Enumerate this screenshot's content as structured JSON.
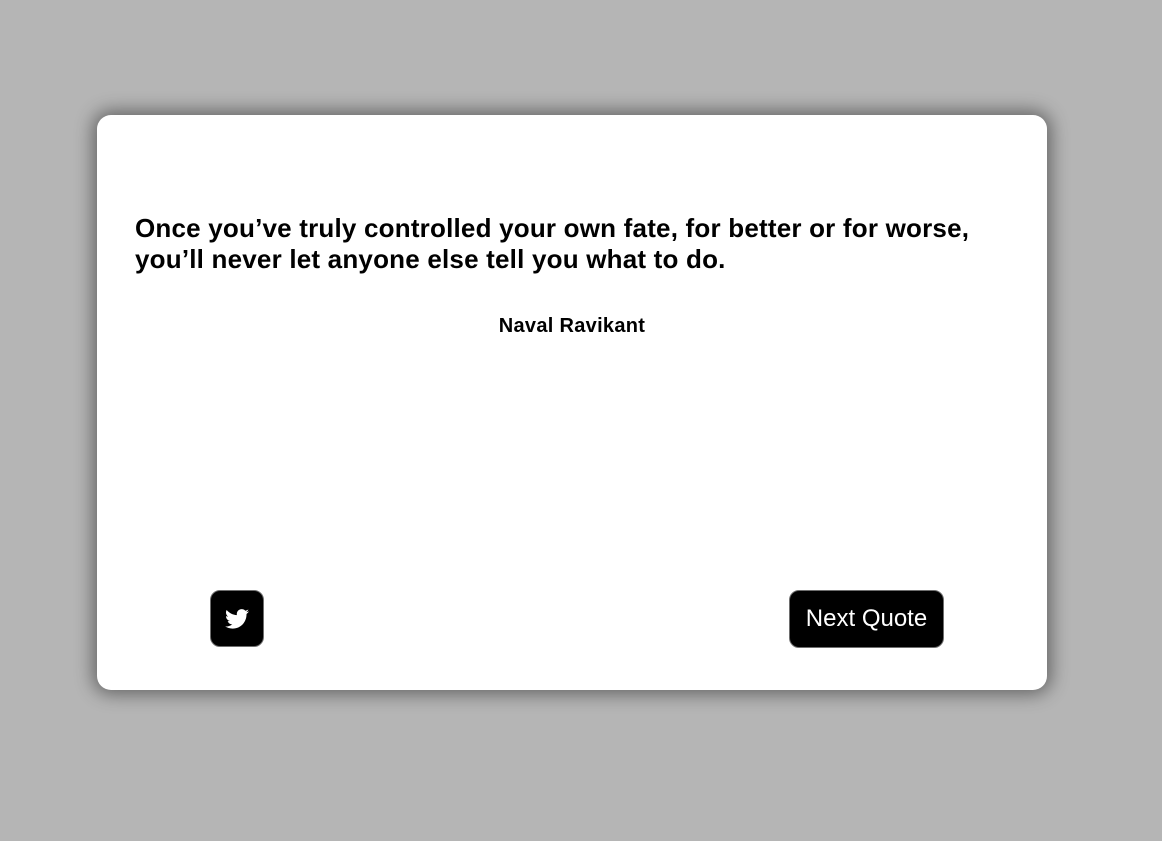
{
  "quote": {
    "text": "Once you’ve truly controlled your own fate, for better or for worse, you’ll never let anyone else tell you what to do.",
    "author": "Naval Ravikant"
  },
  "actions": {
    "tweet_icon": "twitter-bird-icon",
    "next_label": "Next Quote"
  },
  "colors": {
    "page_background": "#b5b5b5",
    "card_background": "#ffffff",
    "button_background": "#000000",
    "button_text": "#ffffff",
    "text": "#000000"
  }
}
